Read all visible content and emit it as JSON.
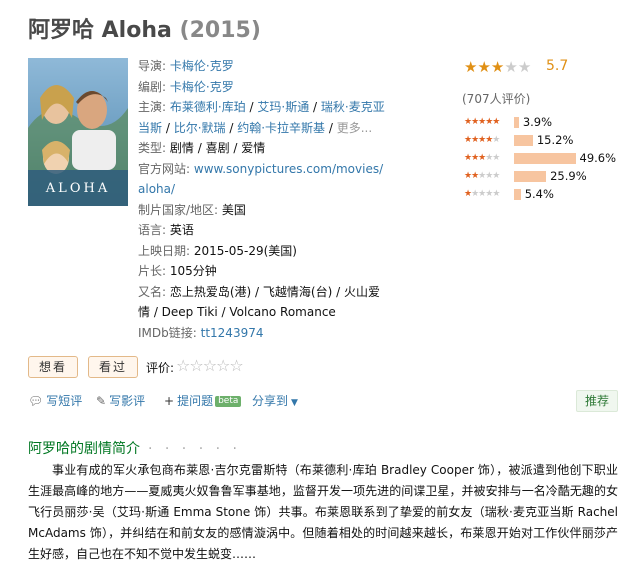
{
  "title": {
    "name": "阿罗哈 Aloha",
    "year": "(2015)"
  },
  "poster": {
    "text": "ALOHA"
  },
  "info": {
    "director_label": "导演:",
    "director": "卡梅伦·克罗",
    "writer_label": "编剧:",
    "writer": "卡梅伦·克罗",
    "cast_label": "主演:",
    "cast": [
      "布莱德利·库珀",
      "艾玛·斯通",
      "瑞秋·麦克亚当斯",
      "比尔·默瑞",
      "约翰·卡拉辛斯基"
    ],
    "cast_sep": " / ",
    "cast_more": "更多...",
    "genre_label": "类型:",
    "genre": [
      "剧情",
      "喜剧",
      "爱情"
    ],
    "site_label": "官方网站:",
    "site": "www.sonypictures.com/movies/aloha/",
    "country_label": "制片国家/地区:",
    "country": "美国",
    "language_label": "语言:",
    "language": "英语",
    "release_label": "上映日期:",
    "release": "2015-05-29(美国)",
    "runtime_label": "片长:",
    "runtime": "105分钟",
    "aka_label": "又名:",
    "aka": "恋上热爱岛(港) / 飞越情海(台) / 火山爱情 / Deep Tiki / Volcano Romance",
    "imdb_label": "IMDb链接:",
    "imdb": "tt1243974"
  },
  "rating": {
    "score": "5.7",
    "score_value": 5.7,
    "votes": "(707人评价)",
    "color": "#e09015",
    "bars": [
      {
        "stars": 5,
        "percent": "3.9%",
        "value": 3.9
      },
      {
        "stars": 4,
        "percent": "15.2%",
        "value": 15.2
      },
      {
        "stars": 3,
        "percent": "49.6%",
        "value": 49.6
      },
      {
        "stars": 2,
        "percent": "25.9%",
        "value": 25.9
      },
      {
        "stars": 1,
        "percent": "5.4%",
        "value": 5.4
      }
    ]
  },
  "buttons": {
    "want": "想看",
    "seen": "看过",
    "rate_label": "评价:"
  },
  "actions": {
    "short_review": "写短评",
    "review": "写影评",
    "question": "提问题",
    "beta": "beta",
    "share": "分享到",
    "recommend": "推荐"
  },
  "summary": {
    "title": "阿罗哈的剧情简介",
    "dots": "· · · · · ·",
    "text": "事业有成的军火承包商布莱恩·吉尔克雷斯特（布莱德利·库珀 Bradley Cooper 饰），被派遣到他创下职业生涯最高峰的地方——夏威夷火奴鲁鲁军事基地，监督开发一项先进的间谍卫星，并被安排与一名冷酷无趣的女飞行员丽莎·吴（艾玛·斯通 Emma Stone 饰）共事。布莱恩联系到了挚爱的前女友（瑞秋·麦克亚当斯 Rachel McAdams 饰），并纠结在和前女友的感情漩涡中。但随着相处的时间越来越长，布莱恩开始对工作伙伴丽莎产生好感，自己也在不知不觉中发生蜕变……"
  }
}
